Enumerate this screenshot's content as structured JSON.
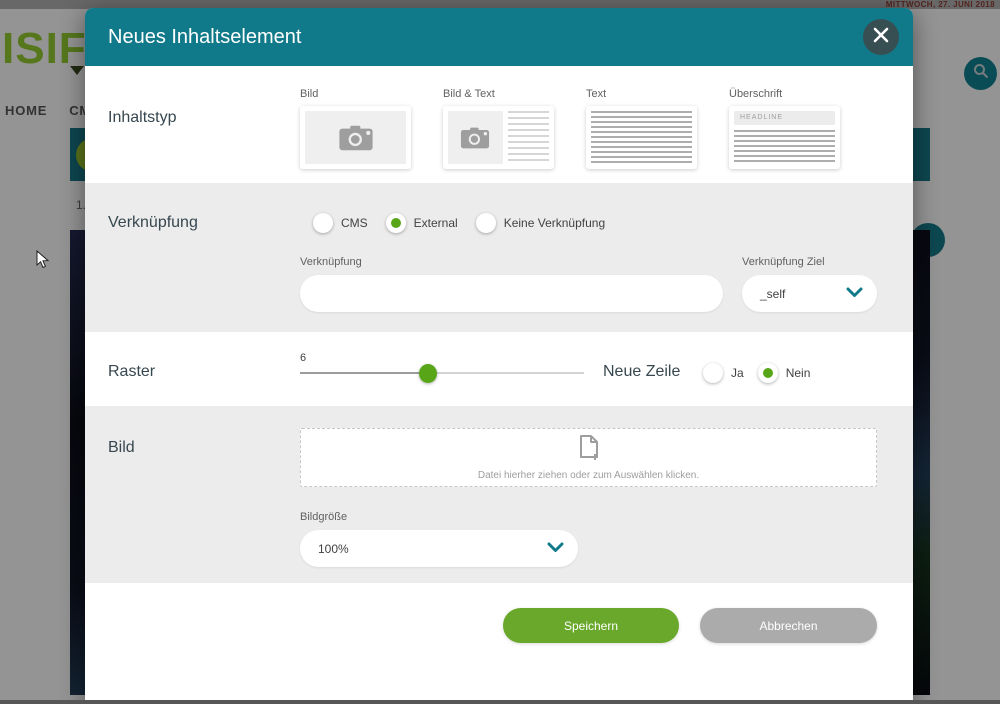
{
  "topbar": {
    "date_text": "MITTWOCH, 27. JUNI 2018"
  },
  "background": {
    "logo_text": "ISIFIV",
    "nav_items": {
      "home": "HOME",
      "cms": "CMS"
    },
    "list_number": "1."
  },
  "modal": {
    "title": "Neues Inhaltselement",
    "inhaltstyp": {
      "label": "Inhaltstyp",
      "options": [
        {
          "label": "Bild",
          "icon": "camera-icon"
        },
        {
          "label": "Bild & Text",
          "icon": "camera-and-text-icon"
        },
        {
          "label": "Text",
          "icon": "text-lines-icon"
        },
        {
          "label": "Überschrift",
          "icon": "headline-icon",
          "headline_placeholder": "HEADLINE"
        }
      ]
    },
    "verknuepfung": {
      "label": "Verknüpfung",
      "radio_options": [
        {
          "label": "CMS",
          "selected": false
        },
        {
          "label": "External",
          "selected": true
        },
        {
          "label": "Keine Verknüpfung",
          "selected": false
        }
      ],
      "link_label": "Verknüpfung",
      "link_value": "",
      "target_label": "Verknüpfung Ziel",
      "target_value": "_self"
    },
    "raster": {
      "label": "Raster",
      "value": "6",
      "neue_zeile_label": "Neue Zeile",
      "radio_options": [
        {
          "label": "Ja",
          "selected": false
        },
        {
          "label": "Nein",
          "selected": true
        }
      ]
    },
    "bild": {
      "label": "Bild",
      "dropzone_text": "Datei hierher ziehen oder zum Auswählen klicken.",
      "size_label": "Bildgröße",
      "size_value": "100%"
    },
    "buttons": {
      "save": "Speichern",
      "cancel": "Abbrechen"
    }
  },
  "colors": {
    "accent_teal": "#117a8a",
    "accent_green": "#58a618",
    "save_green": "#69a82a",
    "cancel_gray": "#ababab",
    "section_gray": "#ececec"
  }
}
